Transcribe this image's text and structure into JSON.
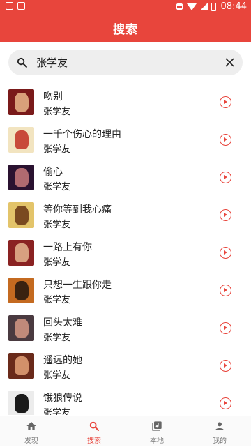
{
  "status_bar": {
    "time": "08:44"
  },
  "header": {
    "title": "搜索"
  },
  "search": {
    "value": "张学友",
    "placeholder": ""
  },
  "results": [
    {
      "title": "吻别",
      "artist": "张学友",
      "c1": "#7a1a1a",
      "c2": "#d9a07a"
    },
    {
      "title": "一千个伤心的理由",
      "artist": "张学友",
      "c1": "#f2e4c0",
      "c2": "#c84a3a"
    },
    {
      "title": "偷心",
      "artist": "张学友",
      "c1": "#2a1230",
      "c2": "#b06a70"
    },
    {
      "title": "等你等到我心痛",
      "artist": "张学友",
      "c1": "#e3c46a",
      "c2": "#7a4a20"
    },
    {
      "title": "一路上有你",
      "artist": "张学友",
      "c1": "#8a2222",
      "c2": "#d8a080"
    },
    {
      "title": "只想一生跟你走",
      "artist": "张学友",
      "c1": "#c46a20",
      "c2": "#3a2210"
    },
    {
      "title": "回头太难",
      "artist": "张学友",
      "c1": "#4a3a40",
      "c2": "#c08a7a"
    },
    {
      "title": "遥远的她",
      "artist": "张学友",
      "c1": "#6a2a1a",
      "c2": "#d2906a"
    },
    {
      "title": "饿狼传说",
      "artist": "张学友",
      "c1": "#ececec",
      "c2": "#1a1a1a"
    }
  ],
  "bottom_nav": [
    {
      "label": "发现",
      "icon": "home-icon",
      "active": false
    },
    {
      "label": "搜索",
      "icon": "search-icon",
      "active": true
    },
    {
      "label": "本地",
      "icon": "music-library-icon",
      "active": false
    },
    {
      "label": "我的",
      "icon": "person-icon",
      "active": false
    }
  ],
  "colors": {
    "accent": "#e8453c"
  }
}
